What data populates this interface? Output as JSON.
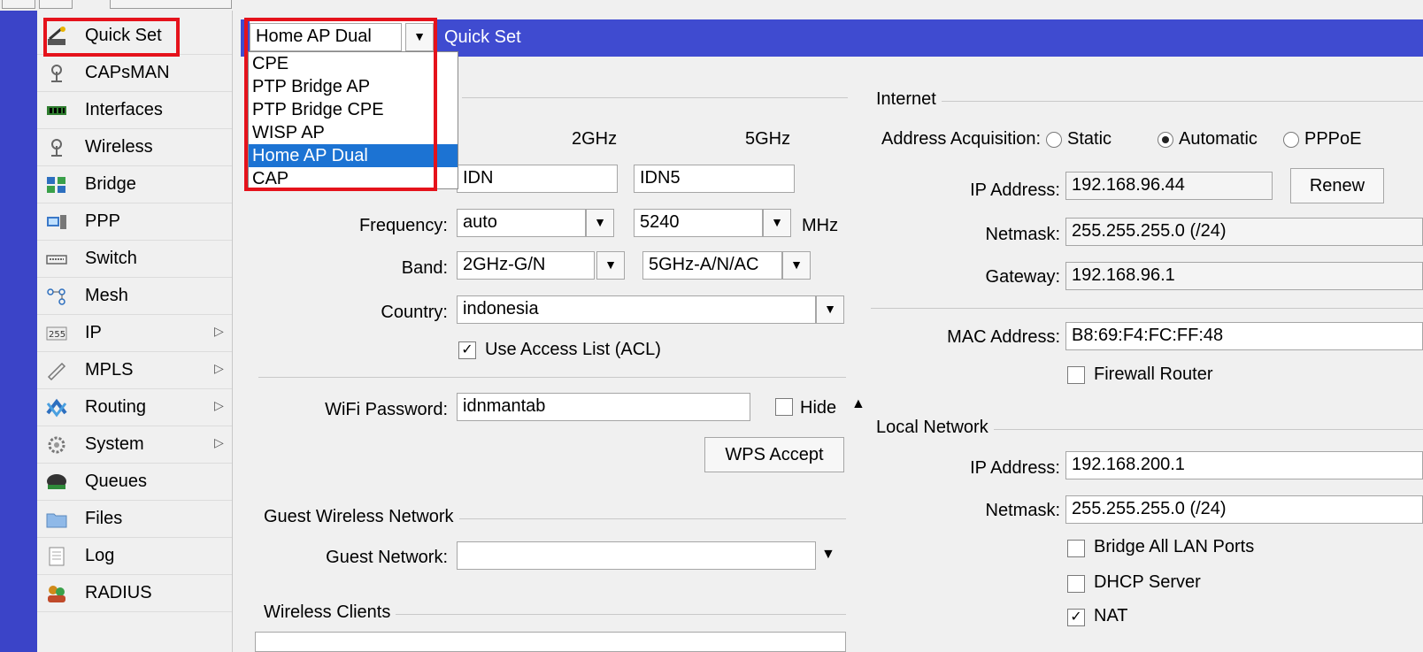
{
  "sidebar": {
    "items": [
      {
        "label": "Quick Set",
        "icon": "quickset-wand-icon",
        "submenu": false
      },
      {
        "label": "CAPsMAN",
        "icon": "antenna-icon",
        "submenu": false
      },
      {
        "label": "Interfaces",
        "icon": "interfaces-icon",
        "submenu": false
      },
      {
        "label": "Wireless",
        "icon": "wireless-antenna-icon",
        "submenu": false
      },
      {
        "label": "Bridge",
        "icon": "bridge-icon",
        "submenu": false
      },
      {
        "label": "PPP",
        "icon": "ppp-icon",
        "submenu": false
      },
      {
        "label": "Switch",
        "icon": "switch-icon",
        "submenu": false
      },
      {
        "label": "Mesh",
        "icon": "mesh-icon",
        "submenu": false
      },
      {
        "label": "IP",
        "icon": "ip-icon",
        "submenu": true
      },
      {
        "label": "MPLS",
        "icon": "mpls-icon",
        "submenu": true
      },
      {
        "label": "Routing",
        "icon": "routing-icon",
        "submenu": true
      },
      {
        "label": "System",
        "icon": "system-gear-icon",
        "submenu": true
      },
      {
        "label": "Queues",
        "icon": "queues-icon",
        "submenu": false
      },
      {
        "label": "Files",
        "icon": "folder-icon",
        "submenu": false
      },
      {
        "label": "Log",
        "icon": "log-icon",
        "submenu": false
      },
      {
        "label": "RADIUS",
        "icon": "radius-users-icon",
        "submenu": false
      }
    ]
  },
  "window": {
    "title": "Quick Set",
    "mode_value": "Home AP Dual",
    "mode_options": [
      "CPE",
      "PTP Bridge AP",
      "PTP Bridge CPE",
      "WISP AP",
      "Home AP Dual",
      "CAP"
    ]
  },
  "wireless": {
    "col_2ghz": "2GHz",
    "col_5ghz": "5GHz",
    "ssid_2ghz": "IDN",
    "ssid_5ghz": "IDN5",
    "frequency_label": "Frequency:",
    "frequency_2ghz": "auto",
    "frequency_5ghz": "5240",
    "frequency_unit": "MHz",
    "band_label": "Band:",
    "band_2ghz": "2GHz-G/N",
    "band_5ghz": "5GHz-A/N/AC",
    "country_label": "Country:",
    "country_value": "indonesia",
    "acl_label": "Use Access List (ACL)",
    "acl_checked": true,
    "password_label": "WiFi Password:",
    "password_value": "idnmantab",
    "hide_label": "Hide",
    "hide_checked": false,
    "wps_label": "WPS Accept"
  },
  "guest": {
    "section_label": "Guest Wireless Network",
    "network_label": "Guest Network:",
    "network_value": ""
  },
  "clients": {
    "section_label": "Wireless Clients"
  },
  "internet": {
    "section_label": "Internet",
    "acq_label": "Address Acquisition:",
    "acq_options": [
      "Static",
      "Automatic",
      "PPPoE"
    ],
    "acq_selected": "Automatic",
    "ip_label": "IP Address:",
    "ip_value": "192.168.96.44",
    "renew_label": "Renew",
    "netmask_label": "Netmask:",
    "netmask_value": "255.255.255.0 (/24)",
    "gateway_label": "Gateway:",
    "gateway_value": "192.168.96.1",
    "mac_label": "MAC Address:",
    "mac_value": "B8:69:F4:FC:FF:48",
    "firewall_label": "Firewall Router",
    "firewall_checked": false
  },
  "local": {
    "section_label": "Local Network",
    "ip_label": "IP Address:",
    "ip_value": "192.168.200.1",
    "netmask_label": "Netmask:",
    "netmask_value": "255.255.255.0 (/24)",
    "bridge_label": "Bridge All LAN Ports",
    "bridge_checked": false,
    "dhcp_label": "DHCP Server",
    "dhcp_checked": false,
    "nat_label": "NAT",
    "nat_checked": true
  },
  "colors": {
    "titlebar": "#3f4bd0",
    "stripe": "#3b44c8",
    "highlight": "#e5121b",
    "selection": "#1c73d3"
  }
}
